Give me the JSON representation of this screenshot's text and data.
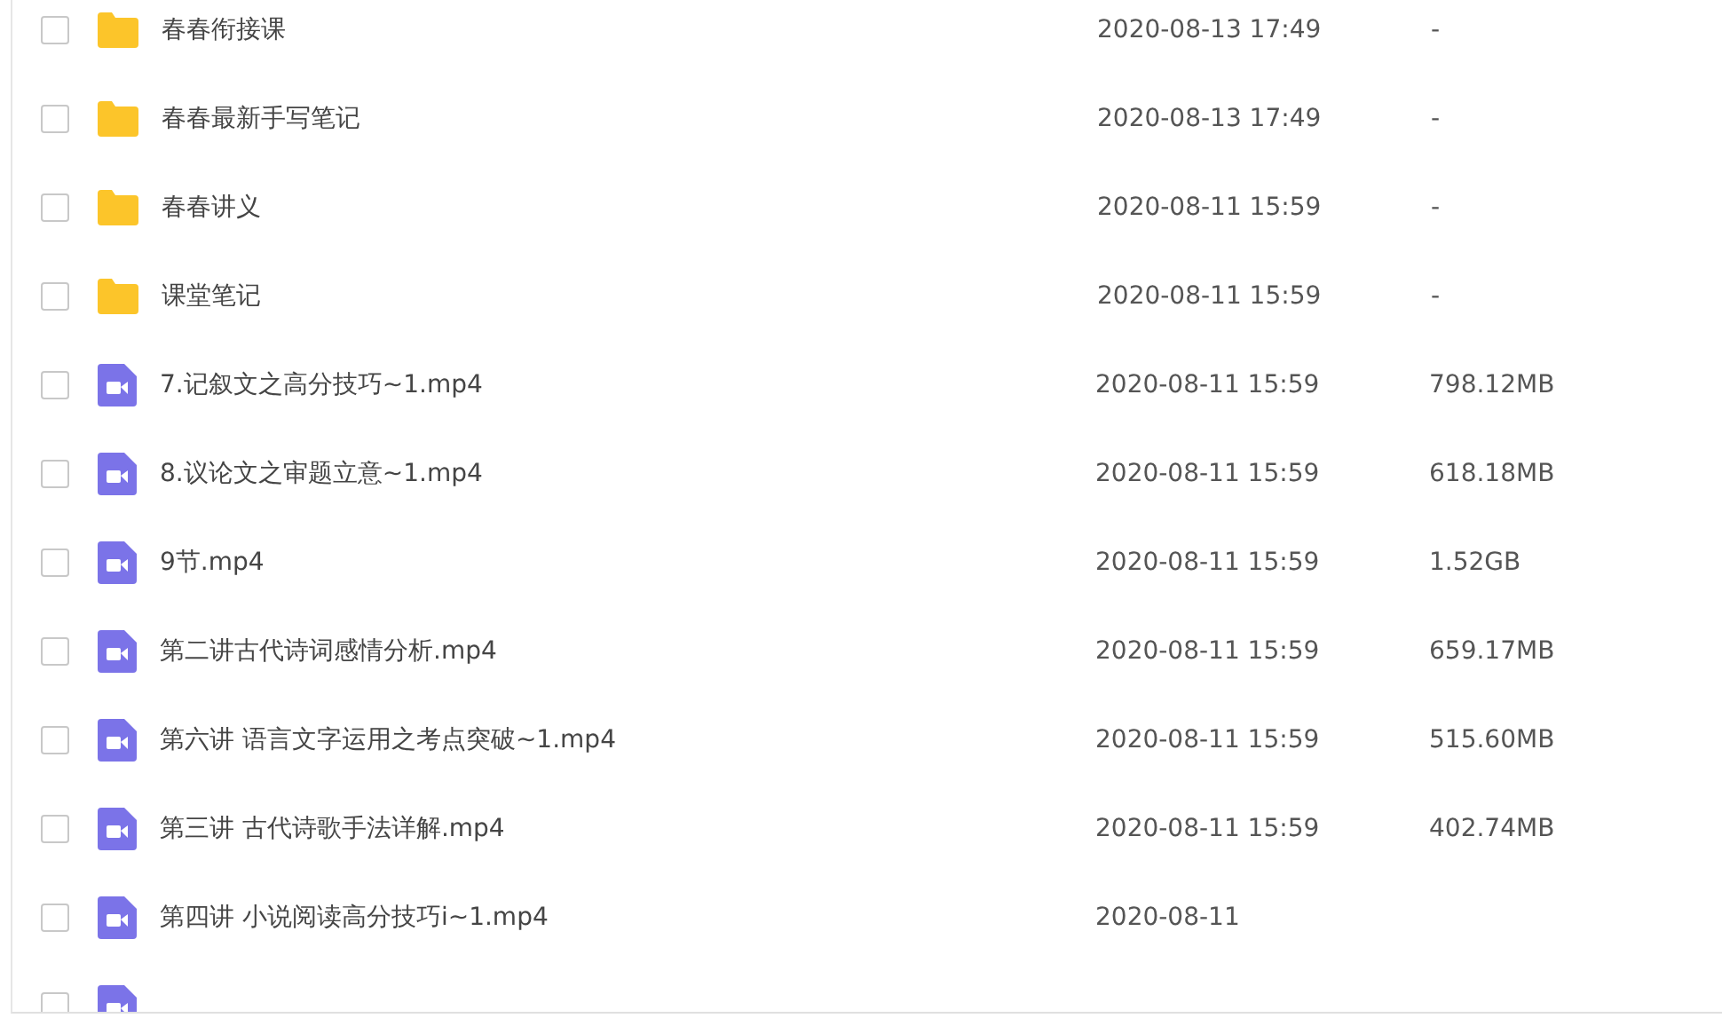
{
  "files": [
    {
      "kind": "folder",
      "name": "春春衔接课",
      "modified": "2020-08-13 17:49",
      "size": "-",
      "checked": false
    },
    {
      "kind": "folder",
      "name": "春春最新手写笔记",
      "modified": "2020-08-13 17:49",
      "size": "-",
      "checked": false
    },
    {
      "kind": "folder",
      "name": "春春讲义",
      "modified": "2020-08-11 15:59",
      "size": "-",
      "checked": false
    },
    {
      "kind": "folder",
      "name": "课堂笔记",
      "modified": "2020-08-11 15:59",
      "size": "-",
      "checked": false
    },
    {
      "kind": "video",
      "name": "7.记叙文之高分技巧~1.mp4",
      "modified": "2020-08-11 15:59",
      "size": "798.12MB",
      "checked": false
    },
    {
      "kind": "video",
      "name": "8.议论文之审题立意~1.mp4",
      "modified": "2020-08-11 15:59",
      "size": "618.18MB",
      "checked": false
    },
    {
      "kind": "video",
      "name": "9节.mp4",
      "modified": "2020-08-11 15:59",
      "size": "1.52GB",
      "checked": false
    },
    {
      "kind": "video",
      "name": "第二讲古代诗词感情分析.mp4",
      "modified": "2020-08-11 15:59",
      "size": "659.17MB",
      "checked": false
    },
    {
      "kind": "video",
      "name": "第六讲 语言文字运用之考点突破~1.mp4",
      "modified": "2020-08-11 15:59",
      "size": "515.60MB",
      "checked": false
    },
    {
      "kind": "video",
      "name": "第三讲 古代诗歌手法详解.mp4",
      "modified": "2020-08-11 15:59",
      "size": "402.74MB",
      "checked": false
    },
    {
      "kind": "video",
      "name": "第四讲 小说阅读高分技巧i~1.mp4",
      "modified": "2020-08-11",
      "checked": false
    },
    {
      "kind": "video",
      "checked": false
    }
  ]
}
